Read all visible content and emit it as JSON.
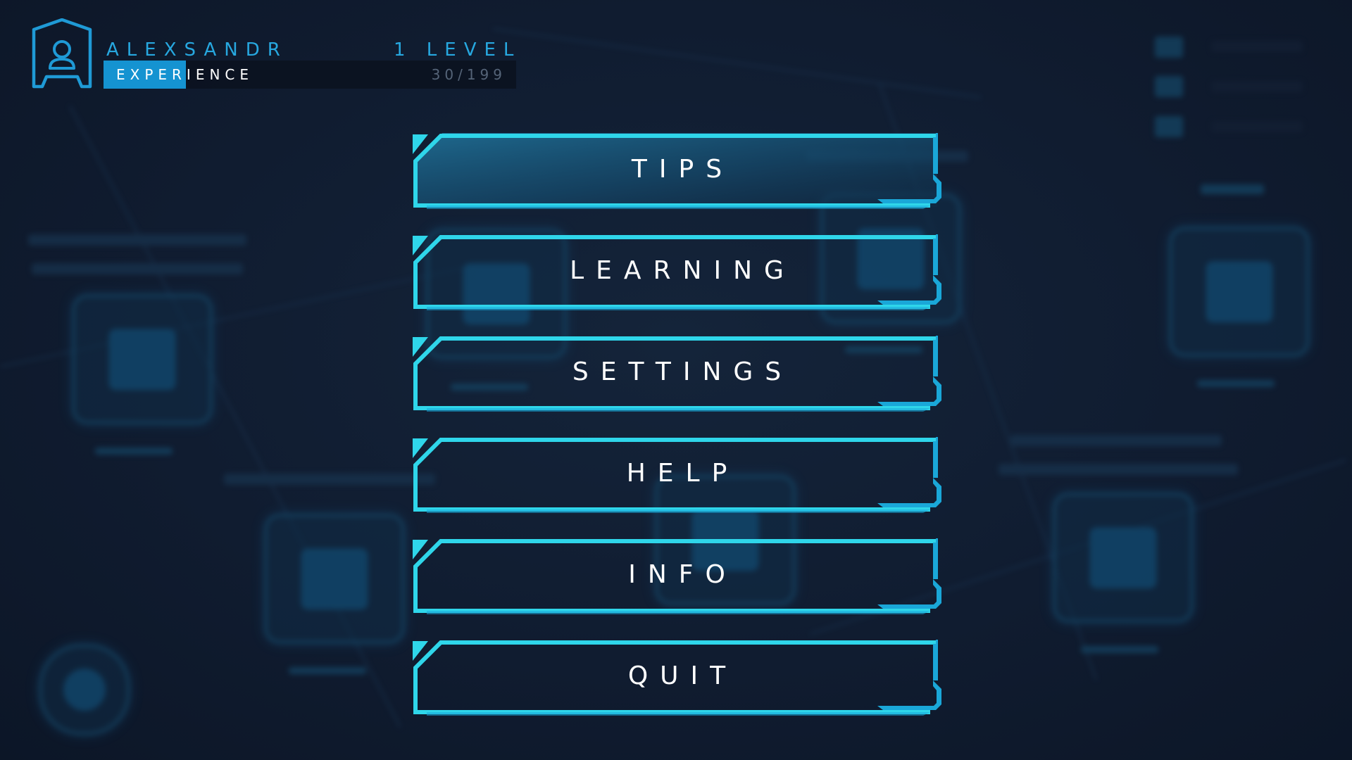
{
  "player": {
    "name": "ALEXSANDR",
    "level_label": "1 LEVEL",
    "xp_label": "EXPERIENCE",
    "xp_value_text": "30/199",
    "xp_current": 30,
    "xp_max": 199
  },
  "menu": {
    "items": [
      {
        "id": "tips",
        "label": "TIPS",
        "active": true
      },
      {
        "id": "learning",
        "label": "LEARNING",
        "active": false
      },
      {
        "id": "settings",
        "label": "SETTINGS",
        "active": false
      },
      {
        "id": "help",
        "label": "HELP",
        "active": false
      },
      {
        "id": "info",
        "label": "INFO",
        "active": false
      },
      {
        "id": "quit",
        "label": "QUIT",
        "active": false
      }
    ]
  },
  "colors": {
    "accent": "#27a8e0",
    "frame": "#2fd6ea",
    "xp_fill": "#1593d1",
    "background": "#0f1a2c",
    "text": "#ffffff"
  },
  "icons": {
    "avatar": "user-icon"
  }
}
